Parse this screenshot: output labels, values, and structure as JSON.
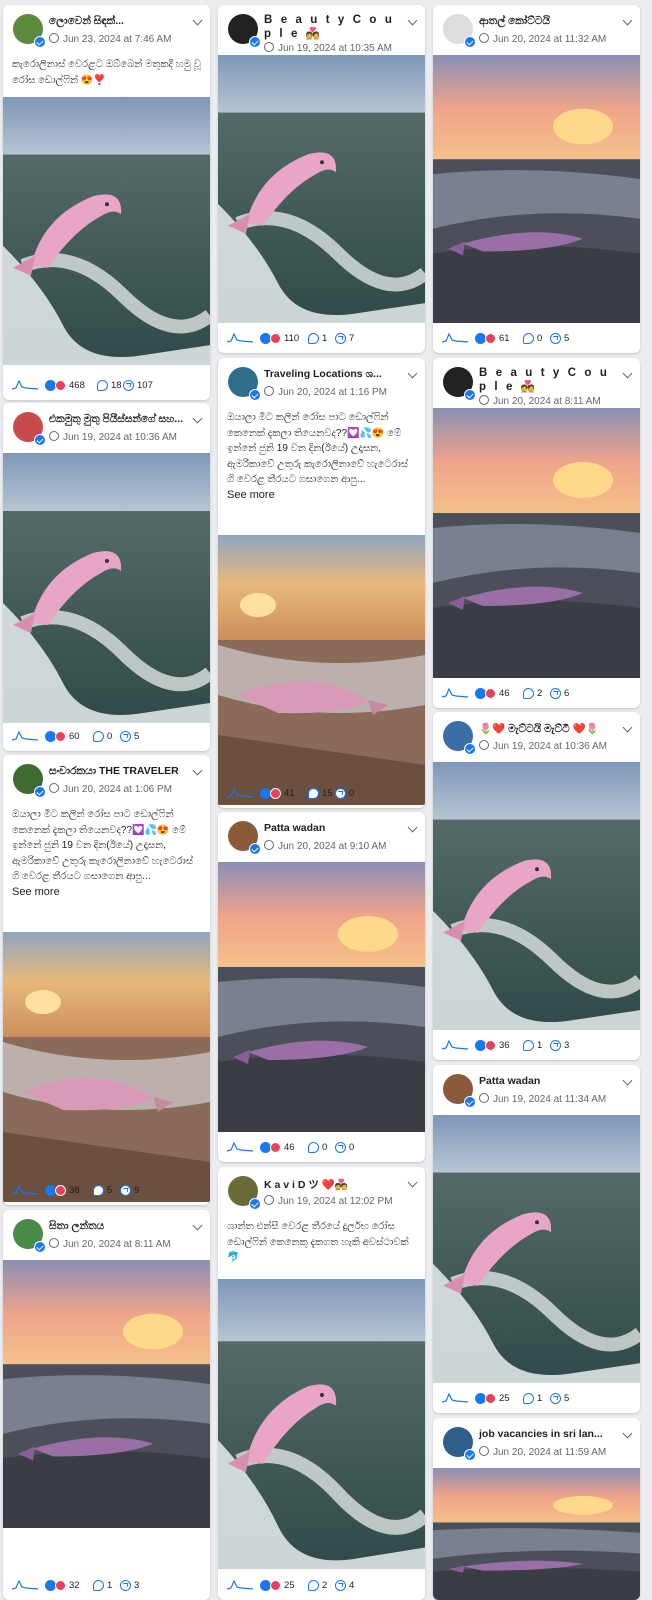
{
  "posts": [
    {
      "author": "ලොවෙන් සිඳක්...",
      "date": "Jun 23, 2024 at 7:46 AM",
      "caption": "කැරොලිනාස් වෙරළට ඔබ්බෙන් මතුකදී හමු වූ රෝස ඩොල්ෆින් 😍❣️",
      "see_more": "",
      "reactions": "468",
      "comments": "18",
      "shares": "107",
      "avatar": "#5b8a3c",
      "scene": "dolphin"
    },
    {
      "author": "එකමුතු මුතු පියීස්සන්ගේ සහ...",
      "date": "Jun 19, 2024 at 10:36 AM",
      "caption": "",
      "see_more": "",
      "reactions": "60",
      "comments": "0",
      "shares": "5",
      "avatar": "#c84b4b",
      "scene": "dolphin"
    },
    {
      "author": "සංචාරකයා THE TRAVELER",
      "date": "Jun 20, 2024 at 1:06 PM",
      "caption": "ඔයාලා මීට කලින් රෝස පාට ඩොල්ෆින් කෙනෙක් දැකලා තියෙනවද??💟💦😍 මේ ඉන්නේ ජුනි 19 වන දින(ඊයේ) උදෑසන, ඇමරිකාවේ උතුරු කැරොලිනාවේ හැටෙරාස් ගි වෙරළ තීරයට ගසාගෙන ආපු...",
      "see_more": "See more",
      "reactions": "38",
      "comments": "5",
      "shares": "9",
      "avatar": "#3d6b30",
      "scene": "beach"
    },
    {
      "author": "සිතා ලන්තය",
      "date": "Jun 20, 2024 at 8:11 AM",
      "caption": "",
      "see_more": "",
      "reactions": "32",
      "comments": "1",
      "shares": "3",
      "avatar": "#4a8b4a",
      "scene": "sunset"
    },
    {
      "author": "B e a u t y  C o u p l e 💑",
      "date": "Jun 19, 2024 at 10:35 AM",
      "caption": "",
      "see_more": "",
      "reactions": "110",
      "comments": "1",
      "shares": "7",
      "avatar": "#222222",
      "scene": "dolphin"
    },
    {
      "author": "Traveling Locations ශ...",
      "date": "Jun 20, 2024 at 1:16 PM",
      "caption": "ඔයාලා මීට කලින් රෝස පාට ඩොල්ෆින් කෙනෙක් දැකලා තියෙනවද??💟💦😍 මේ ඉන්නේ ජුනි 19 වන දින(ඊයේ) උදෑසන, ඇමරිකාවේ උතුරු කැරොලිනාවේ හැටෙරාස් ගි වෙරළ තීරයට ගසාගෙන ආපු...",
      "see_more": "See more",
      "reactions": "41",
      "comments": "15",
      "shares": "0",
      "avatar": "#2f6e8a",
      "scene": "beach"
    },
    {
      "author": "Patta wadan",
      "date": "Jun 20, 2024 at 9:10 AM",
      "caption": "",
      "see_more": "",
      "reactions": "46",
      "comments": "0",
      "shares": "0",
      "avatar": "#8a5a3a",
      "scene": "sunset"
    },
    {
      "author": "K a v i  D ツ ❤️💑",
      "date": "Jun 19, 2024 at 12:02 PM",
      "caption": "ශාන්ත එන්සී වෙරළ තීරයේ දුර්ලභ රෝස ඩොල්ෆින් කෙනෙකු දැකගත හැකි අවස්ථාවක් 🐬",
      "see_more": "",
      "reactions": "25",
      "comments": "2",
      "shares": "4",
      "avatar": "#6b6b3a",
      "scene": "dolphin"
    },
    {
      "author": "ආතල් කෝට්ටයි",
      "date": "Jun 20, 2024 at 11:32 AM",
      "caption": "",
      "see_more": "",
      "reactions": "61",
      "comments": "0",
      "shares": "5",
      "avatar": "#dddddd",
      "scene": "sunset"
    },
    {
      "author": "B e a u t y  C o u p l e 💑",
      "date": "Jun 20, 2024 at 8:11 AM",
      "caption": "",
      "see_more": "",
      "reactions": "46",
      "comments": "2",
      "shares": "6",
      "avatar": "#222222",
      "scene": "sunset"
    },
    {
      "author": "🌷❤️ මැට්ටයි මැට්ටී ❤️🌷",
      "date": "Jun 19, 2024 at 10:36 AM",
      "caption": "",
      "see_more": "",
      "reactions": "36",
      "comments": "1",
      "shares": "3",
      "avatar": "#3a6ea5",
      "scene": "dolphin"
    },
    {
      "author": "Patta wadan",
      "date": "Jun 19, 2024 at 11:34 AM",
      "caption": "",
      "see_more": "",
      "reactions": "25",
      "comments": "1",
      "shares": "5",
      "avatar": "#8a5a3a",
      "scene": "dolphin"
    },
    {
      "author": "job vacancies in sri lan...",
      "date": "Jun 20, 2024 at 11:59 AM",
      "caption": "",
      "see_more": "",
      "reactions": "",
      "comments": "",
      "shares": "",
      "avatar": "#2e5e8a",
      "scene": "sunset"
    }
  ]
}
